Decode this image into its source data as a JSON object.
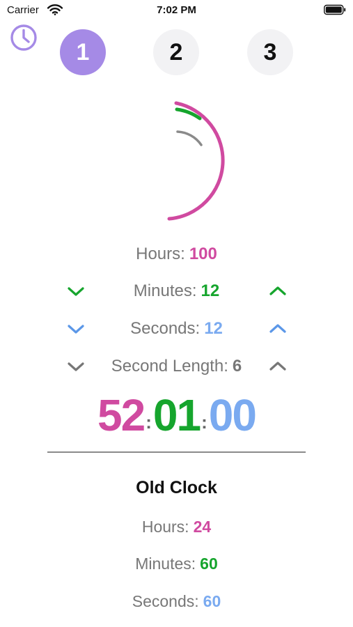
{
  "status_bar": {
    "carrier": "Carrier",
    "time": "7:02 PM"
  },
  "nav": {
    "pages": [
      {
        "label": "1",
        "active": true
      },
      {
        "label": "2",
        "active": false
      },
      {
        "label": "3",
        "active": false
      }
    ]
  },
  "colors": {
    "hours": "#d04aa0",
    "minutes": "#16a52d",
    "seconds": "#7aaaf0",
    "second_length": "#777777",
    "accent": "#a58ae6",
    "label": "#777777"
  },
  "counters": {
    "hours": {
      "label": "Hours:",
      "value": "100"
    },
    "minutes": {
      "label": "Minutes:",
      "value": "12"
    },
    "seconds": {
      "label": "Seconds:",
      "value": "12"
    },
    "second_length": {
      "label": "Second Length:",
      "value": "6"
    }
  },
  "display": {
    "hours": "52",
    "minutes": "01",
    "seconds": "00",
    "separator": ":"
  },
  "old_clock": {
    "title": "Old Clock",
    "hours": {
      "label": "Hours:",
      "value": "24"
    },
    "minutes": {
      "label": "Minutes:",
      "value": "60"
    },
    "seconds": {
      "label": "Seconds:",
      "value": "60"
    }
  }
}
